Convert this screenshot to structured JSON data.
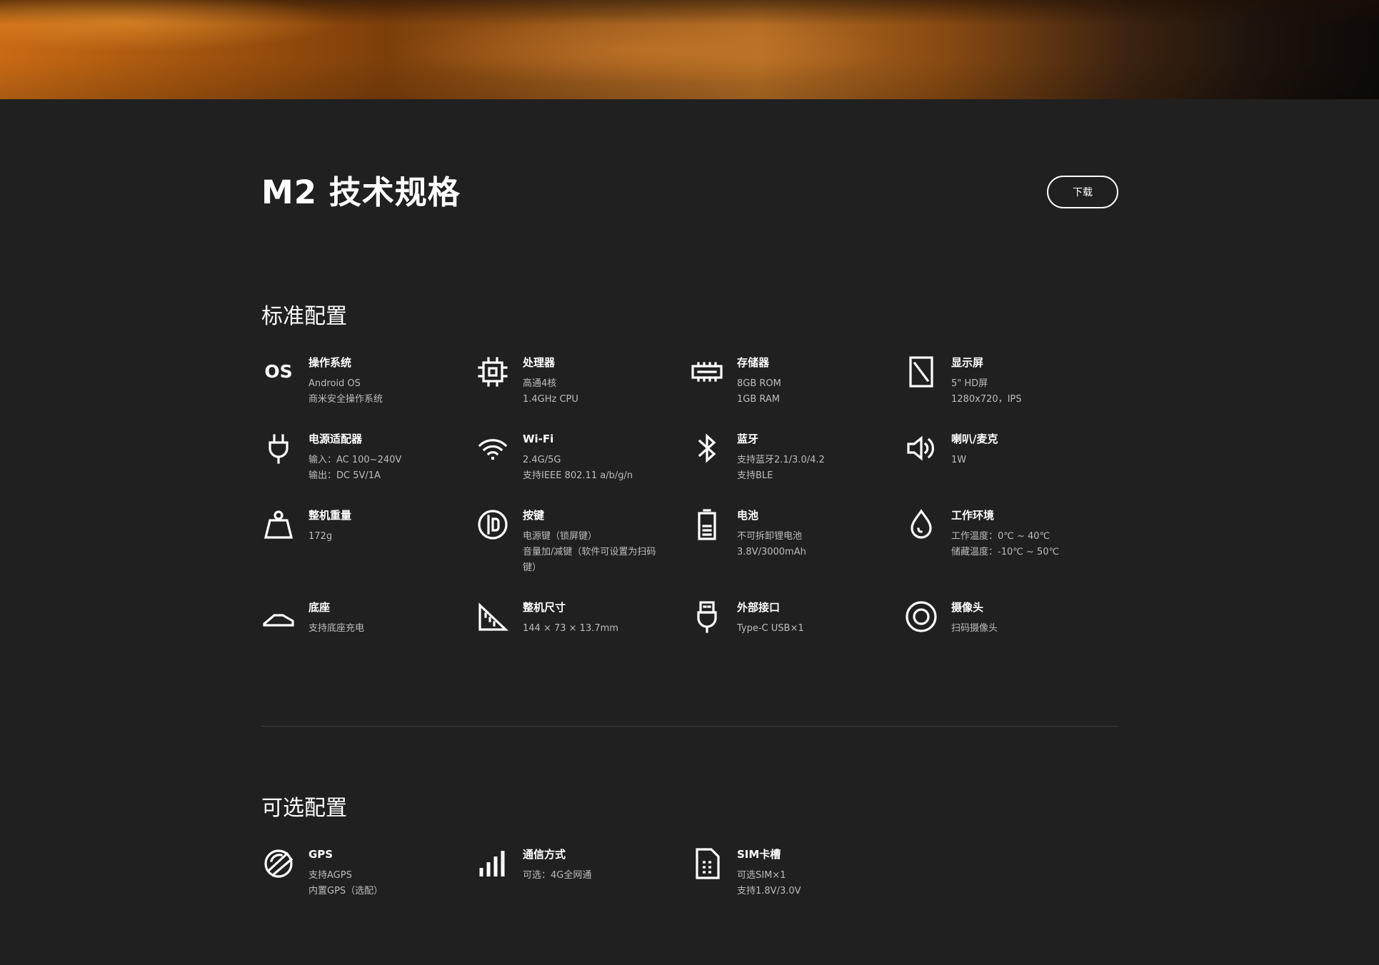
{
  "title": "M2 技术规格",
  "download_label": "下载",
  "standard": {
    "title": "标准配置",
    "items": [
      {
        "icon": "os-icon",
        "name": "操作系统",
        "lines": [
          "Android OS",
          "商米安全操作系统"
        ]
      },
      {
        "icon": "cpu-icon",
        "name": "处理器",
        "lines": [
          "高通4核",
          "1.4GHz CPU"
        ]
      },
      {
        "icon": "memory-icon",
        "name": "存储器",
        "lines": [
          "8GB ROM",
          "1GB RAM"
        ]
      },
      {
        "icon": "display-icon",
        "name": "显示屏",
        "lines": [
          "5\" HD屏",
          "1280x720，IPS"
        ]
      },
      {
        "icon": "power-plug-icon",
        "name": "电源适配器",
        "lines": [
          "输入：AC 100~240V",
          "输出：DC 5V/1A"
        ]
      },
      {
        "icon": "wifi-icon",
        "name": "Wi-Fi",
        "lines": [
          "2.4G/5G",
          "支持IEEE 802.11 a/b/g/n"
        ]
      },
      {
        "icon": "bluetooth-icon",
        "name": "蓝牙",
        "lines": [
          "支持蓝牙2.1/3.0/4.2",
          "支持BLE"
        ]
      },
      {
        "icon": "speaker-icon",
        "name": "喇叭/麦克",
        "lines": [
          "1W"
        ]
      },
      {
        "icon": "weight-icon",
        "name": "整机重量",
        "lines": [
          "172g"
        ]
      },
      {
        "icon": "button-icon",
        "name": "按键",
        "lines": [
          "电源键（锁屏键）",
          "音量加/减键（软件可设置为扫码",
          "键）"
        ]
      },
      {
        "icon": "battery-icon",
        "name": "电池",
        "lines": [
          "不可拆卸锂电池",
          "3.8V/3000mAh"
        ]
      },
      {
        "icon": "droplet-icon",
        "name": "工作环境",
        "lines": [
          "工作温度：0℃ ~ 40℃",
          "储藏温度：-10℃ ~ 50℃"
        ]
      },
      {
        "icon": "dock-icon",
        "name": "底座",
        "lines": [
          "支持底座充电"
        ]
      },
      {
        "icon": "ruler-triangle-icon",
        "name": "整机尺寸",
        "lines": [
          "144 × 73 × 13.7mm"
        ]
      },
      {
        "icon": "usb-plug-icon",
        "name": "外部接口",
        "lines": [
          "Type-C USB×1"
        ]
      },
      {
        "icon": "camera-icon",
        "name": "摄像头",
        "lines": [
          "扫码摄像头"
        ]
      }
    ]
  },
  "optional": {
    "title": "可选配置",
    "items": [
      {
        "icon": "gps-icon",
        "name": "GPS",
        "lines": [
          "支持AGPS",
          "内置GPS（选配）"
        ]
      },
      {
        "icon": "signal-bars-icon",
        "name": "通信方式",
        "lines": [
          "可选：4G全网通"
        ]
      },
      {
        "icon": "sim-card-icon",
        "name": "SIM卡槽",
        "lines": [
          "可选SIM×1",
          "支持1.8V/3.0V"
        ]
      }
    ]
  }
}
